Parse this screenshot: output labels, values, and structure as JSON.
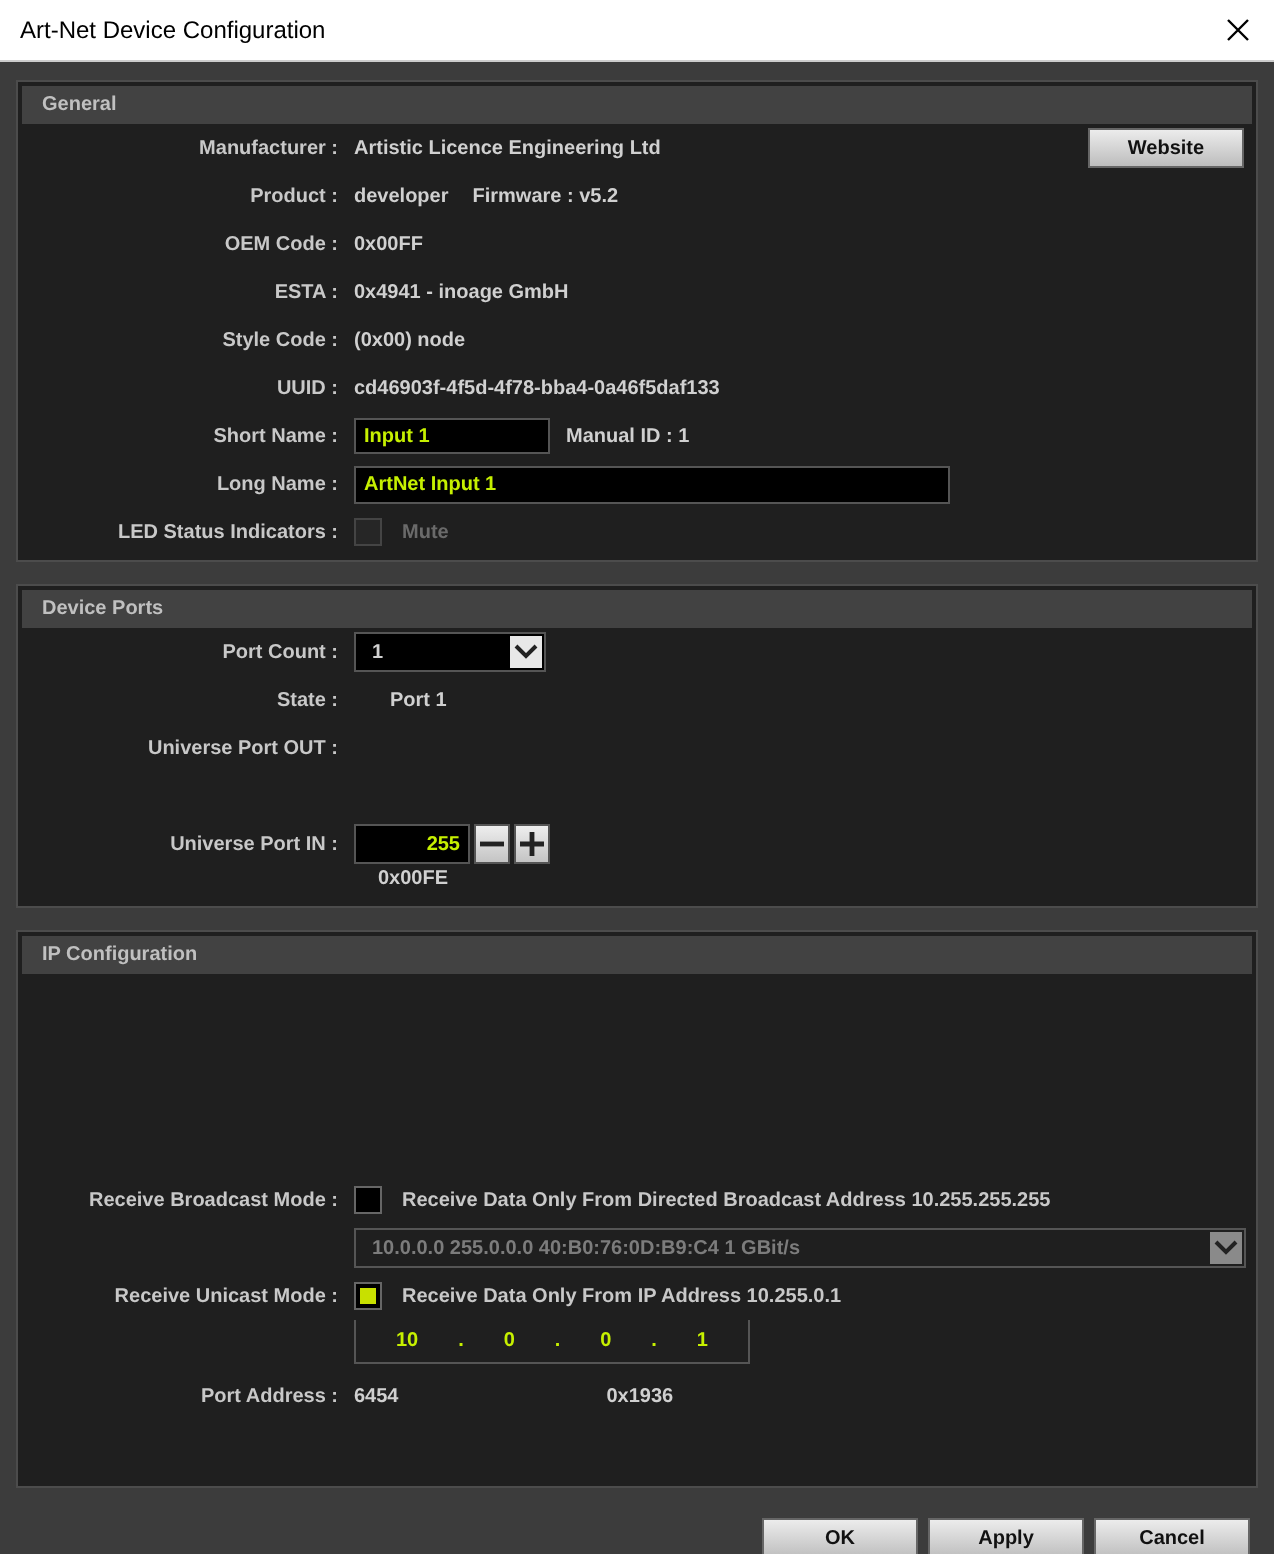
{
  "window": {
    "title": "Art-Net Device Configuration"
  },
  "sections": [
    {
      "title": "General",
      "rows": [
        {
          "kind": "text",
          "label": "Manufacturer :",
          "value": "Artistic Licence Engineering Ltd",
          "button": "Website"
        },
        {
          "kind": "text",
          "label": "Product :",
          "value": "developer",
          "extra": "Firmware : v5.2"
        },
        {
          "kind": "text",
          "label": "OEM Code :",
          "value": "0x00FF"
        },
        {
          "kind": "text",
          "label": "ESTA :",
          "value": "0x4941 - inoage GmbH"
        },
        {
          "kind": "text",
          "label": "Style Code :",
          "value": "(0x00) node"
        },
        {
          "kind": "text",
          "label": "UUID :",
          "value": "cd46903f-4f5d-4f78-bba4-0a46f5daf133"
        },
        {
          "kind": "field",
          "label": "Short Name :",
          "value": "Input 1",
          "extra": "Manual ID : 1"
        },
        {
          "kind": "wide_field",
          "label": "Long Name :",
          "value": "ArtNet Input 1"
        },
        {
          "kind": "checkbox",
          "label": "LED Status Indicators :",
          "text": "Mute",
          "checked": false,
          "disabled": true
        }
      ]
    },
    {
      "title": "Device Ports",
      "rows": [
        {
          "kind": "dropdown",
          "label": "Port Count :",
          "value": "1"
        },
        {
          "kind": "state",
          "label": "State :",
          "value": "Port 1"
        },
        {
          "kind": "label",
          "label": "Universe Port OUT :"
        },
        {
          "kind": "spinner",
          "label": "Universe Port IN :",
          "value": "255",
          "hex": "0x00FE"
        }
      ]
    },
    {
      "title": "IP Configuration",
      "rows": [
        {
          "kind": "checkbox",
          "label": "Receive Broadcast Mode :",
          "text": "Receive Data Only From Directed Broadcast Address 10.255.255.255",
          "checked": false,
          "disabled": false
        },
        {
          "kind": "wide_dropdown",
          "value": "10.0.0.0 255.0.0.0 40:B0:76:0D:B9:C4 1 GBit/s",
          "disabled": true
        },
        {
          "kind": "checkbox",
          "label": "Receive Unicast Mode :",
          "text": "Receive Data Only From IP Address 10.255.0.1",
          "checked": true,
          "disabled": false
        },
        {
          "kind": "ip",
          "octets": [
            "10",
            "0",
            "0",
            "1"
          ],
          "separator": "."
        },
        {
          "kind": "text",
          "label": "Port Address :",
          "value": "6454",
          "extra": "0x1936"
        }
      ]
    }
  ],
  "buttons": [
    {
      "label": "OK"
    },
    {
      "label": "Apply"
    },
    {
      "label": "Cancel"
    }
  ]
}
